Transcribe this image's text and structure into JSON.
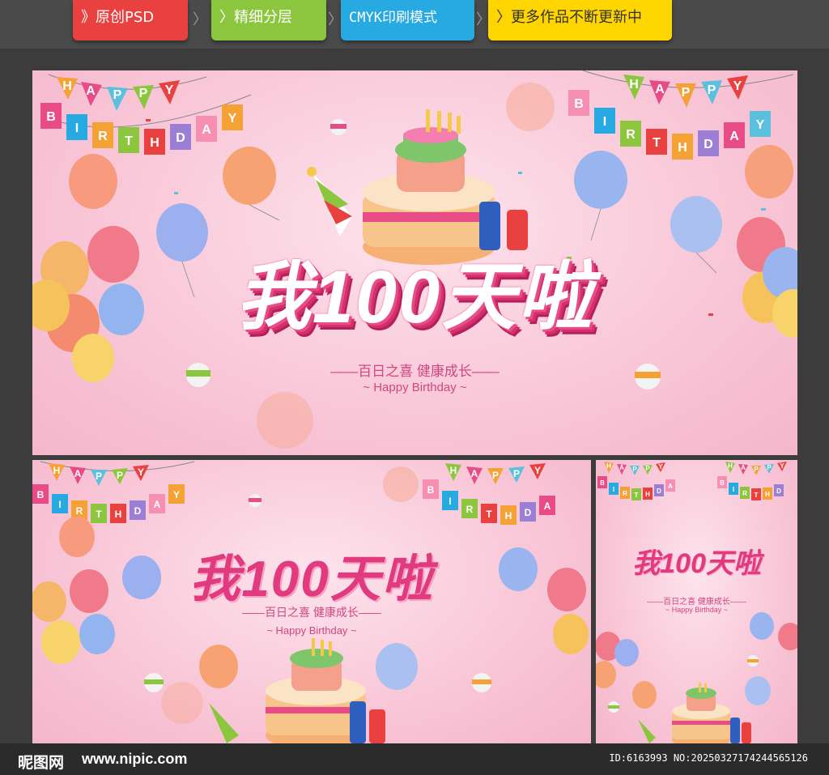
{
  "tags": [
    {
      "label": "》原创PSD",
      "color": "#e8413f"
    },
    {
      "label": "〉精细分层",
      "color": "#8cc63f"
    },
    {
      "label": "CMYK印刷模式",
      "color": "#27a9e1"
    },
    {
      "label": "〉更多作品不断更新中",
      "color": "#ffd500"
    }
  ],
  "separator": "〉",
  "banner": {
    "title": "我100天啦",
    "subtitle": "——百日之喜  健康成长——",
    "english": "~ Happy Birthday ~",
    "bunting_left": [
      "H",
      "A",
      "P",
      "P",
      "Y"
    ],
    "bunting_left2": [
      "B",
      "I",
      "R",
      "T",
      "H",
      "D",
      "A",
      "Y"
    ]
  },
  "footer": {
    "logo": "昵图网",
    "url": "www.nipic.com",
    "id": "ID:6163993 NO:20250327174244565126"
  }
}
